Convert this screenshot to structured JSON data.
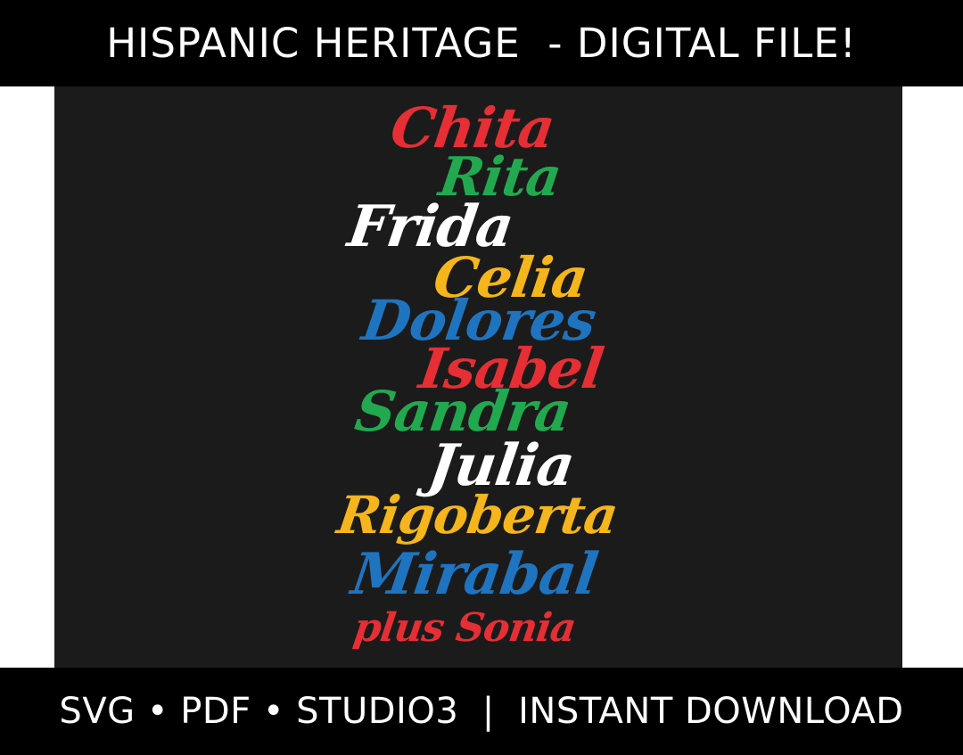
{
  "header": {
    "title": "HISPANIC HERITAGE  - DIGITAL FILE!"
  },
  "artwork": {
    "names": [
      {
        "text": "Chita",
        "color": "#e52f35"
      },
      {
        "text": "Rita",
        "color": "#22a94f"
      },
      {
        "text": "Frida",
        "color": "#ffffff"
      },
      {
        "text": "Celia",
        "color": "#f5b51c"
      },
      {
        "text": "Dolores",
        "color": "#1f74bf"
      },
      {
        "text": "Isabel",
        "color": "#e52f35"
      },
      {
        "text": "Sandra",
        "color": "#22a94f"
      },
      {
        "text": "Julia",
        "color": "#ffffff"
      },
      {
        "text": "Rigoberta",
        "color": "#f5b51c"
      },
      {
        "text": "Mirabal",
        "color": "#1f74bf"
      },
      {
        "text": "plus Sonia",
        "color": "#e52f35"
      }
    ]
  },
  "footer": {
    "formats": "SVG • PDF • STUDIO3  |  INSTANT DOWNLOAD"
  }
}
